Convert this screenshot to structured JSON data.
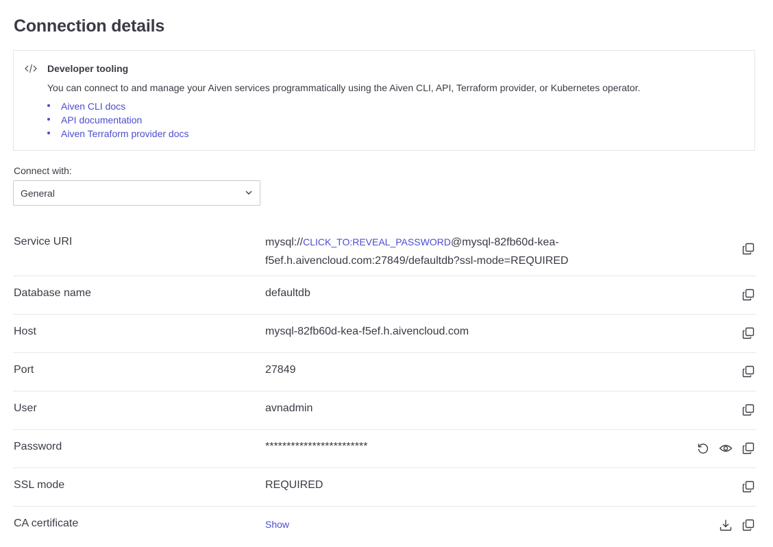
{
  "page": {
    "title": "Connection details"
  },
  "developer_tooling": {
    "title": "Developer tooling",
    "description": "You can connect to and manage your Aiven services programmatically using the Aiven CLI, API, Terraform provider, or Kubernetes operator.",
    "links": [
      "Aiven CLI docs",
      "API documentation",
      "Aiven Terraform provider docs"
    ]
  },
  "connect_with": {
    "label": "Connect with:",
    "selected": "General"
  },
  "rows": {
    "service_uri": {
      "label": "Service URI",
      "prefix": "mysql://",
      "reveal_link": "CLICK_TO:REVEAL_PASSWORD",
      "suffix_line1": "@mysql-82fb60d-kea-",
      "suffix_line2": "f5ef.h.aivencloud.com:27849/defaultdb?ssl-mode=REQUIRED"
    },
    "database_name": {
      "label": "Database name",
      "value": "defaultdb"
    },
    "host": {
      "label": "Host",
      "value": "mysql-82fb60d-kea-f5ef.h.aivencloud.com"
    },
    "port": {
      "label": "Port",
      "value": "27849"
    },
    "user": {
      "label": "User",
      "value": "avnadmin"
    },
    "password": {
      "label": "Password",
      "value": "************************"
    },
    "ssl_mode": {
      "label": "SSL mode",
      "value": "REQUIRED"
    },
    "ca_certificate": {
      "label": "CA certificate",
      "value": "Show"
    }
  },
  "colors": {
    "link": "#4b4ccf",
    "text": "#3a3a44",
    "border": "#e6e7ec"
  },
  "icons": [
    "code-icon",
    "chevron-down-icon",
    "copy-icon",
    "reset-icon",
    "eye-icon",
    "download-icon"
  ]
}
